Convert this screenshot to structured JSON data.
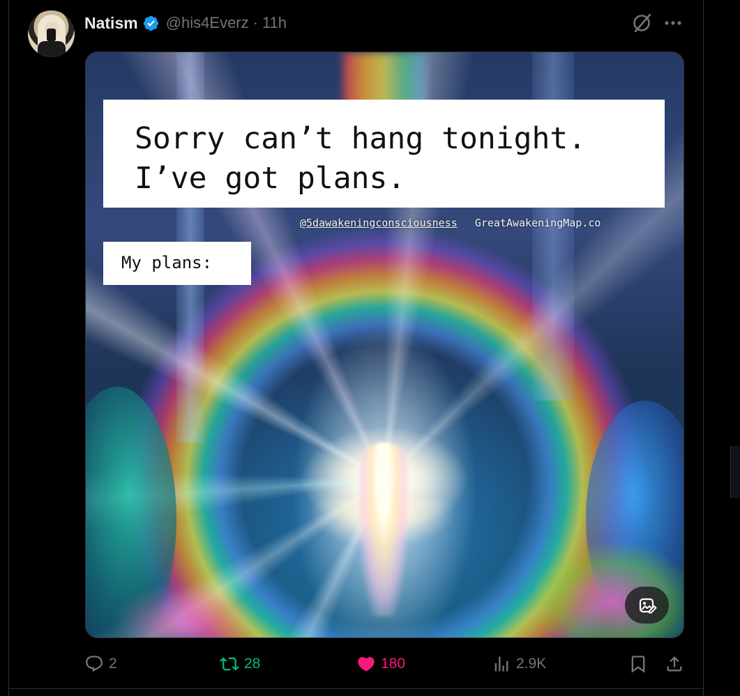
{
  "post": {
    "author": {
      "name": "Natism",
      "handle": "@his4Everz",
      "verified": true,
      "avatar_icon": "avatar-image"
    },
    "separator": "·",
    "time": "11h",
    "header_icons": [
      "grok-icon",
      "more-icon"
    ],
    "media": {
      "meme_top_text": "Sorry can’t hang tonight.\nI’ve got plans.",
      "watermark_handle": "@5dawakeningconsciousness",
      "watermark_site": "GreatAwakeningMap.co",
      "meme_plans_text": "My plans:",
      "badge_icon": "media-edit-icon"
    },
    "actions": {
      "replies": "2",
      "reposts": "28",
      "likes": "180",
      "views": "2.9K"
    }
  },
  "colors": {
    "background": "#000000",
    "text": "#e7e9ea",
    "muted": "#71767b",
    "verified": "#1d9bf0",
    "repost_active": "#00ba7c",
    "like_active": "#f91880",
    "border": "#2f3336"
  }
}
